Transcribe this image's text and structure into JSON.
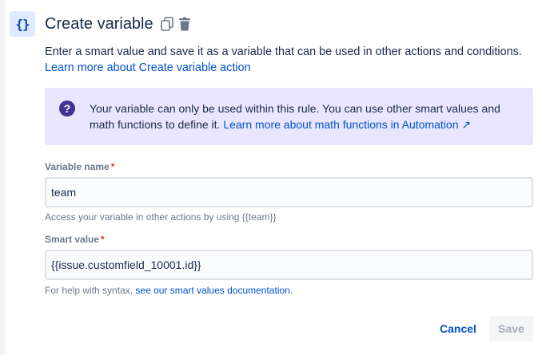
{
  "header": {
    "icon_glyph": "{}",
    "title": "Create variable",
    "copy_icon": "copy-icon",
    "delete_icon": "trash-icon"
  },
  "description": {
    "text": "Enter a smart value and save it as a variable that can be used in other actions and conditions.",
    "link": "Learn more about Create variable action"
  },
  "info": {
    "icon": "question-circle-icon",
    "text": "Your variable can only be used within this rule. You can use other smart values and math functions to define it. ",
    "link": "Learn more about math functions in Automation",
    "link_icon": "↗",
    "background": "#eae6ff",
    "icon_color": "#403294"
  },
  "variable_name": {
    "label": "Variable name",
    "required_mark": "*",
    "value": "team",
    "helper": "Access your variable in other actions by using {{team}}"
  },
  "smart_value": {
    "label": "Smart value",
    "required_mark": "*",
    "value": "{{issue.customfield_10001.id}}",
    "helper_prefix": "For help with syntax, ",
    "helper_link": "see our smart values documentation",
    "helper_suffix": "."
  },
  "actions": {
    "cancel_label": "Cancel",
    "save_label": "Save"
  },
  "colors": {
    "link": "#0052cc",
    "text": "#172b4d",
    "subtle": "#6b778c",
    "required": "#de350b",
    "icon_bg": "#deebff"
  }
}
